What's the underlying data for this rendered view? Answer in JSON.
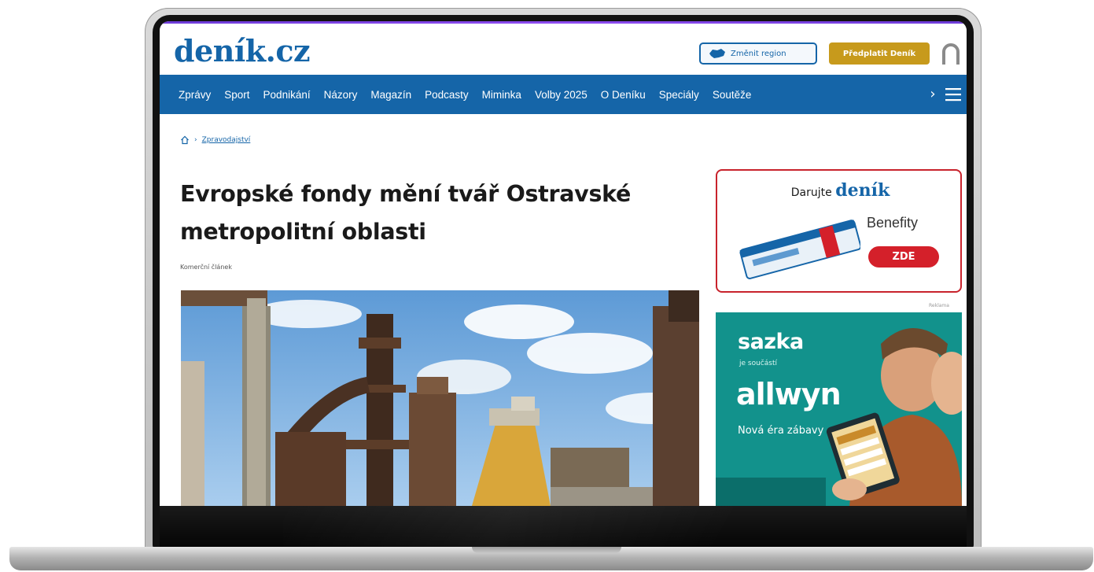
{
  "site": {
    "logo": "deník.cz",
    "region_button": "Změnit region",
    "subscribe_button": "Předplatit Deník"
  },
  "nav": {
    "items": [
      "Zprávy",
      "Sport",
      "Podnikání",
      "Názory",
      "Magazín",
      "Podcasty",
      "Miminka",
      "Volby 2025",
      "O Deníku",
      "Speciály",
      "Soutěže"
    ],
    "more_arrow": "›"
  },
  "breadcrumb": {
    "link": "Zpravodajství"
  },
  "article": {
    "headline": "Evropské fondy mění tvář Ostravské metropolitní oblasti",
    "byline": "Komerční článek"
  },
  "donate_ad": {
    "title_prefix": "Darujte",
    "brand": "deník",
    "benefity": "Benefity",
    "button": "ZDE"
  },
  "sazka_ad": {
    "label": "Reklama",
    "brand": "sazka",
    "sub": "je součástí",
    "brand2": "allwyn",
    "tagline": "Nová éra zábavy"
  },
  "colors": {
    "brand_blue": "#1565a8",
    "subscribe_gold": "#c79a1c",
    "donate_red": "#d4202a",
    "ad_teal": "#0f8f8a"
  }
}
